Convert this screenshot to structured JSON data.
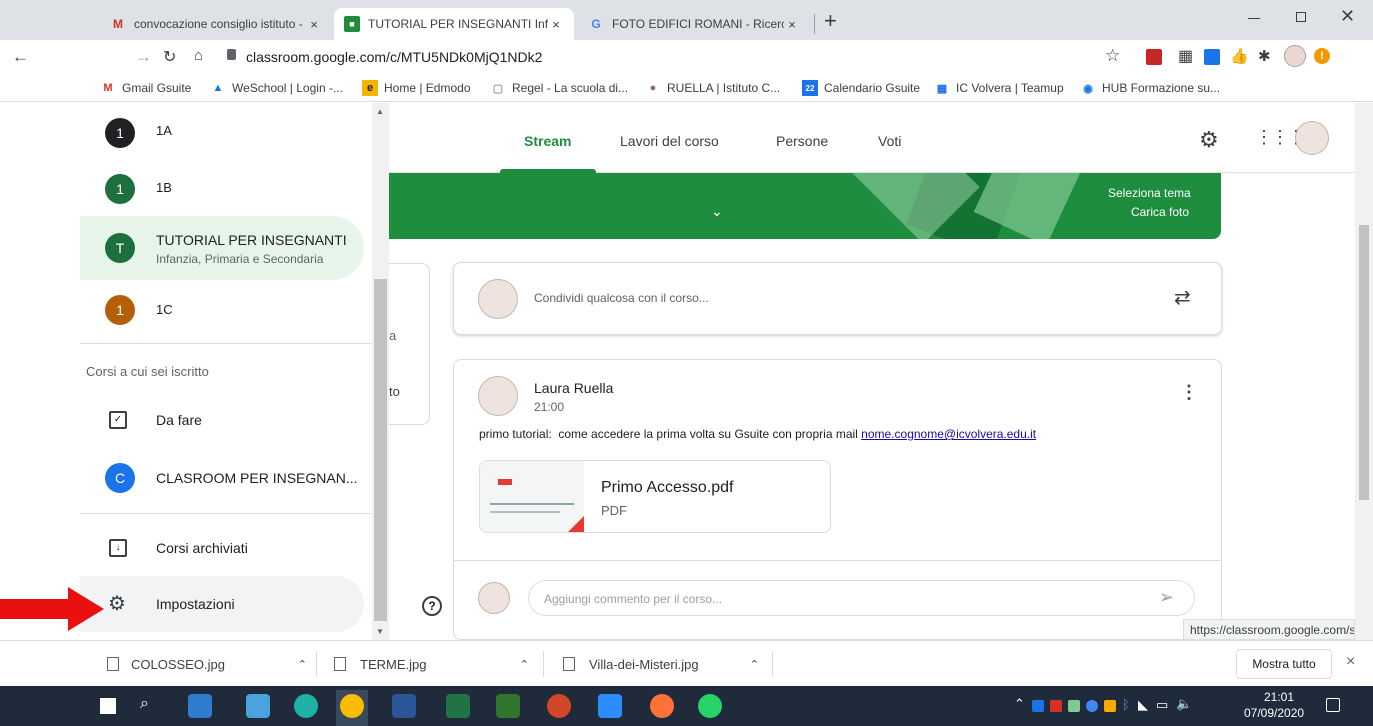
{
  "browser": {
    "tabs": [
      {
        "title": "convocazione consiglio istituto -",
        "favicon": "gmail-icon",
        "close": "×"
      },
      {
        "title": "TUTORIAL PER INSEGNANTI Infa",
        "favicon": "classroom-icon",
        "close": "×"
      },
      {
        "title": "FOTO EDIFICI ROMANI - Ricerca",
        "favicon": "google-icon",
        "close": "×"
      }
    ],
    "new_tab": "+",
    "url": "classroom.google.com/c/MTU5NDk0MjQ1NDk2",
    "bookmarks": [
      "Gmail Gsuite",
      "WeSchool | Login -...",
      "Home | Edmodo",
      "Regel - La scuola di...",
      "RUELLA | Istituto C...",
      "Calendario Gsuite",
      "IC Volvera | Teamup",
      "HUB Formazione su..."
    ]
  },
  "drawer": {
    "classes": [
      {
        "initial": "1",
        "name": "1A",
        "color": "#202124"
      },
      {
        "initial": "1",
        "name": "1B",
        "color": "#1e6f3e"
      },
      {
        "initial": "T",
        "name": "TUTORIAL PER INSEGNANTI",
        "section": "Infanzia, Primaria e Secondaria",
        "color": "#1e6f3e"
      },
      {
        "initial": "1",
        "name": "1C",
        "color": "#b65f0b"
      }
    ],
    "enrolled_header": "Corsi a cui sei iscritto",
    "todo": "Da fare",
    "enrolled": [
      {
        "initial": "C",
        "name": "CLASROOM PER INSEGNAN...",
        "color": "#1a73e8"
      }
    ],
    "archived": "Corsi archiviati",
    "settings": "Impostazioni"
  },
  "classroom": {
    "nav_tabs": [
      "Stream",
      "Lavori del corso",
      "Persone",
      "Voti"
    ],
    "banner": {
      "select_theme": "Seleziona tema",
      "upload_photo": "Carica foto"
    },
    "side_card_fragments": [
      "a",
      "to"
    ],
    "share_placeholder": "Condividi qualcosa con il corso...",
    "post": {
      "author": "Laura Ruella",
      "time": "21:00",
      "text": "primo tutorial:  come accedere la prima volta su Gsuite con propria mail ",
      "link": "nome.cognome@icvolvera.edu.it",
      "attachment": {
        "name": "Primo Accesso.pdf",
        "type": "PDF"
      },
      "comment_placeholder": "Aggiungi commento per il corso..."
    },
    "status_url": "https://classroom.google.com/s"
  },
  "downloads": {
    "files": [
      "COLOSSEO.jpg",
      "TERME.jpg",
      "Villa-dei-Misteri.jpg"
    ],
    "show_all": "Mostra tutto",
    "close": "×"
  },
  "taskbar": {
    "time": "21:01",
    "date": "07/09/2020"
  },
  "colors": {
    "accent_green": "#1e8e3e",
    "banner_green": "#137333",
    "red_arrow": "#e8110f"
  }
}
